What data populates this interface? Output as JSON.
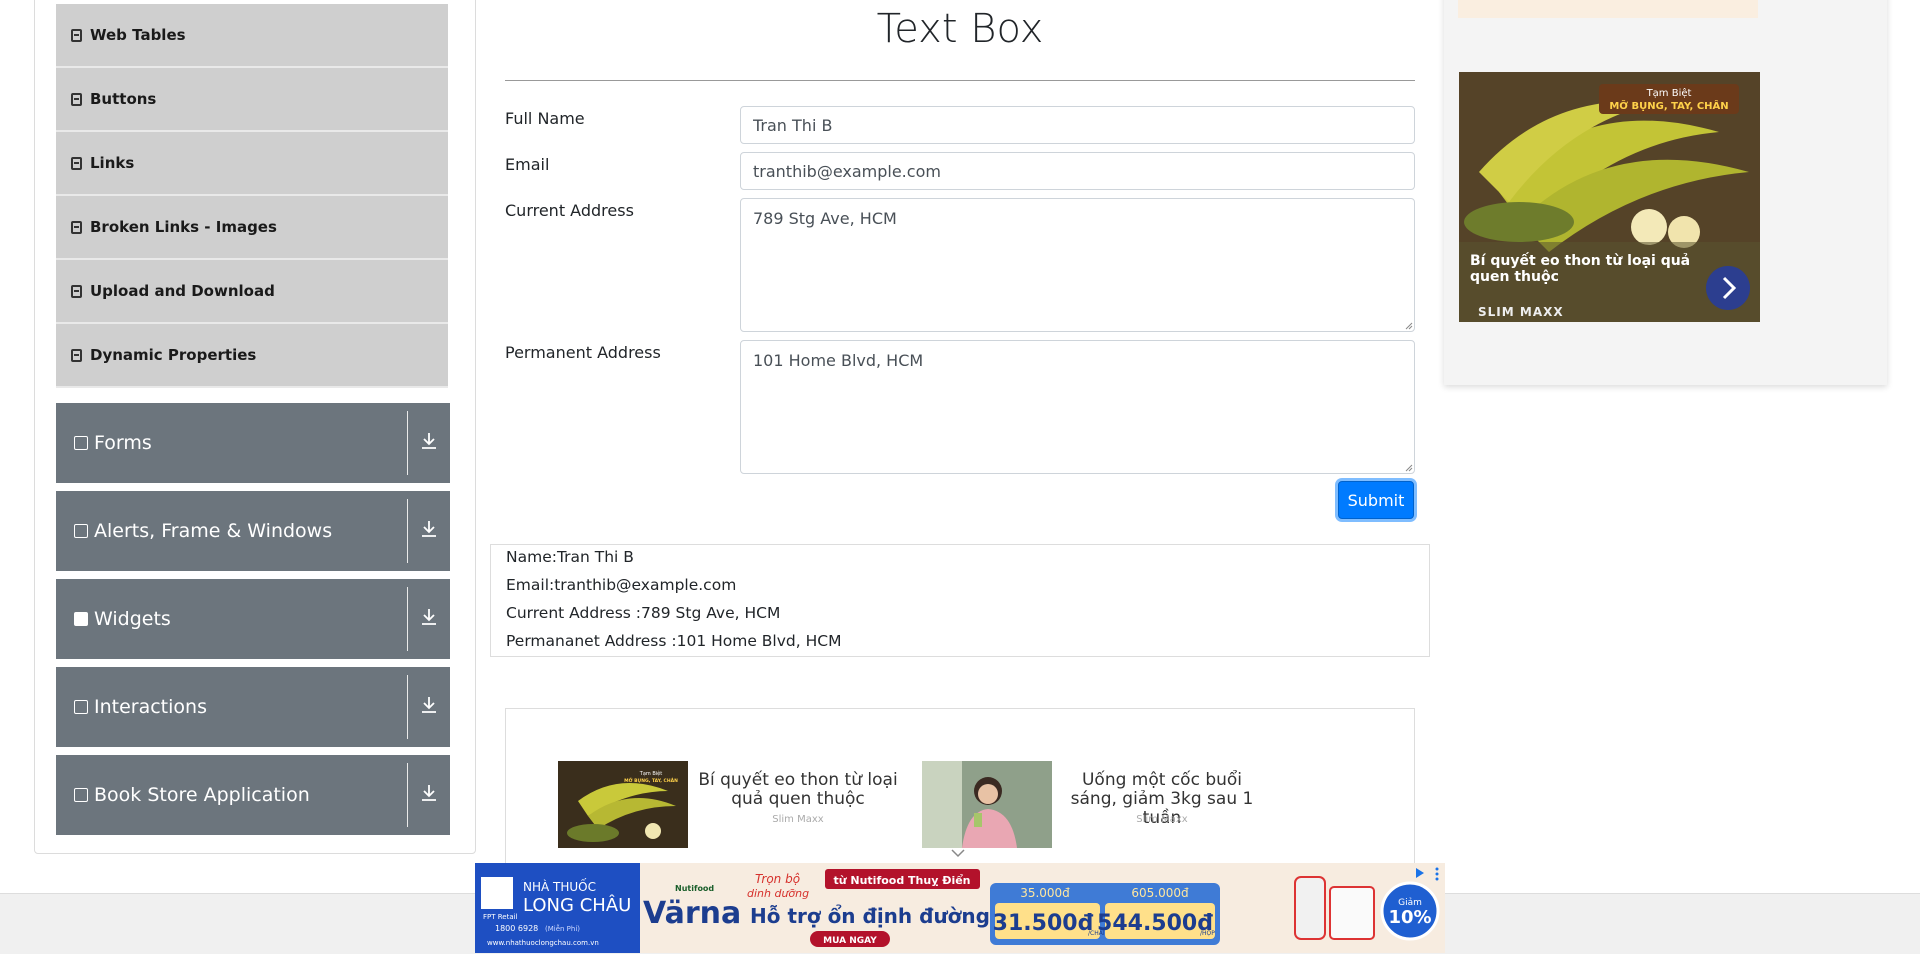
{
  "sidebar": {
    "items": [
      {
        "label": "Web Tables"
      },
      {
        "label": "Buttons"
      },
      {
        "label": "Links"
      },
      {
        "label": "Broken Links - Images"
      },
      {
        "label": "Upload and Download"
      },
      {
        "label": "Dynamic Properties"
      }
    ],
    "groups": [
      {
        "label": "Forms"
      },
      {
        "label": "Alerts, Frame & Windows"
      },
      {
        "label": "Widgets"
      },
      {
        "label": "Interactions"
      },
      {
        "label": "Book Store Application"
      }
    ]
  },
  "main": {
    "title": "Text Box",
    "full_name_label": "Full Name",
    "full_name_value": "Tran Thi B",
    "email_label": "Email",
    "email_value": "tranthib@example.com",
    "current_address_label": "Current Address",
    "current_address_value": "789 Stg Ave, HCM",
    "permanent_address_label": "Permanent Address",
    "permanent_address_value": "101 Home Blvd, HCM",
    "submit_label": "Submit"
  },
  "output": {
    "name": "Name:Tran Thi B",
    "email": "Email:tranthib@example.com",
    "current": "Current Address :789 Stg Ave, HCM",
    "permanent": "Permananet Address :101 Home Blvd, HCM"
  },
  "promo": {
    "cards": [
      {
        "title": "Bí quyết eo thon từ loại quả quen thuộc",
        "source": "Slim Maxx"
      },
      {
        "title": "Uống một cốc buổi sáng, giảm 3kg sau 1 tuần",
        "source": "Slim Maxx"
      }
    ],
    "thumb_caption_1": "Tạm Biệt",
    "thumb_caption_2": "MỠ BỤNG, TAY, CHÂN"
  },
  "right_ad": {
    "badge_1": "Tạm Biệt",
    "badge_2": "MỠ BỤNG, TAY, CHÂN",
    "text": "Bí quyết eo thon từ loại quả quen thuộc",
    "brand": "SLIM MAXX"
  },
  "banner": {
    "store_line1": "NHÀ THUỐC",
    "store_line2": "LONG CHÂU",
    "retail": "FPT Retail",
    "phone": "1800 6928",
    "phone_note": "(Miễn Phí)",
    "url": "www.nhathuoclongchau.com.vn",
    "product": "Värna",
    "maker": "Nutifood",
    "tagline1": "Trọn bộ",
    "tagline2": "dinh dưỡng",
    "origin": "từ Nutifood Thuỵ Điển",
    "headline": "Hỗ trợ ổn định đường huyết",
    "cta": "MUA NGAY",
    "old_price_1": "35.000đ",
    "old_price_2": "605.000đ",
    "price_1": "31.500đ",
    "unit_1": "/CHAI",
    "price_2": "544.500đ",
    "unit_2": "/HỘP",
    "discount_label": "Giảm",
    "discount": "10%"
  },
  "colors": {
    "submit": "#007bff",
    "group_bg": "#6c757d",
    "item_bg": "#cfcfcf"
  }
}
